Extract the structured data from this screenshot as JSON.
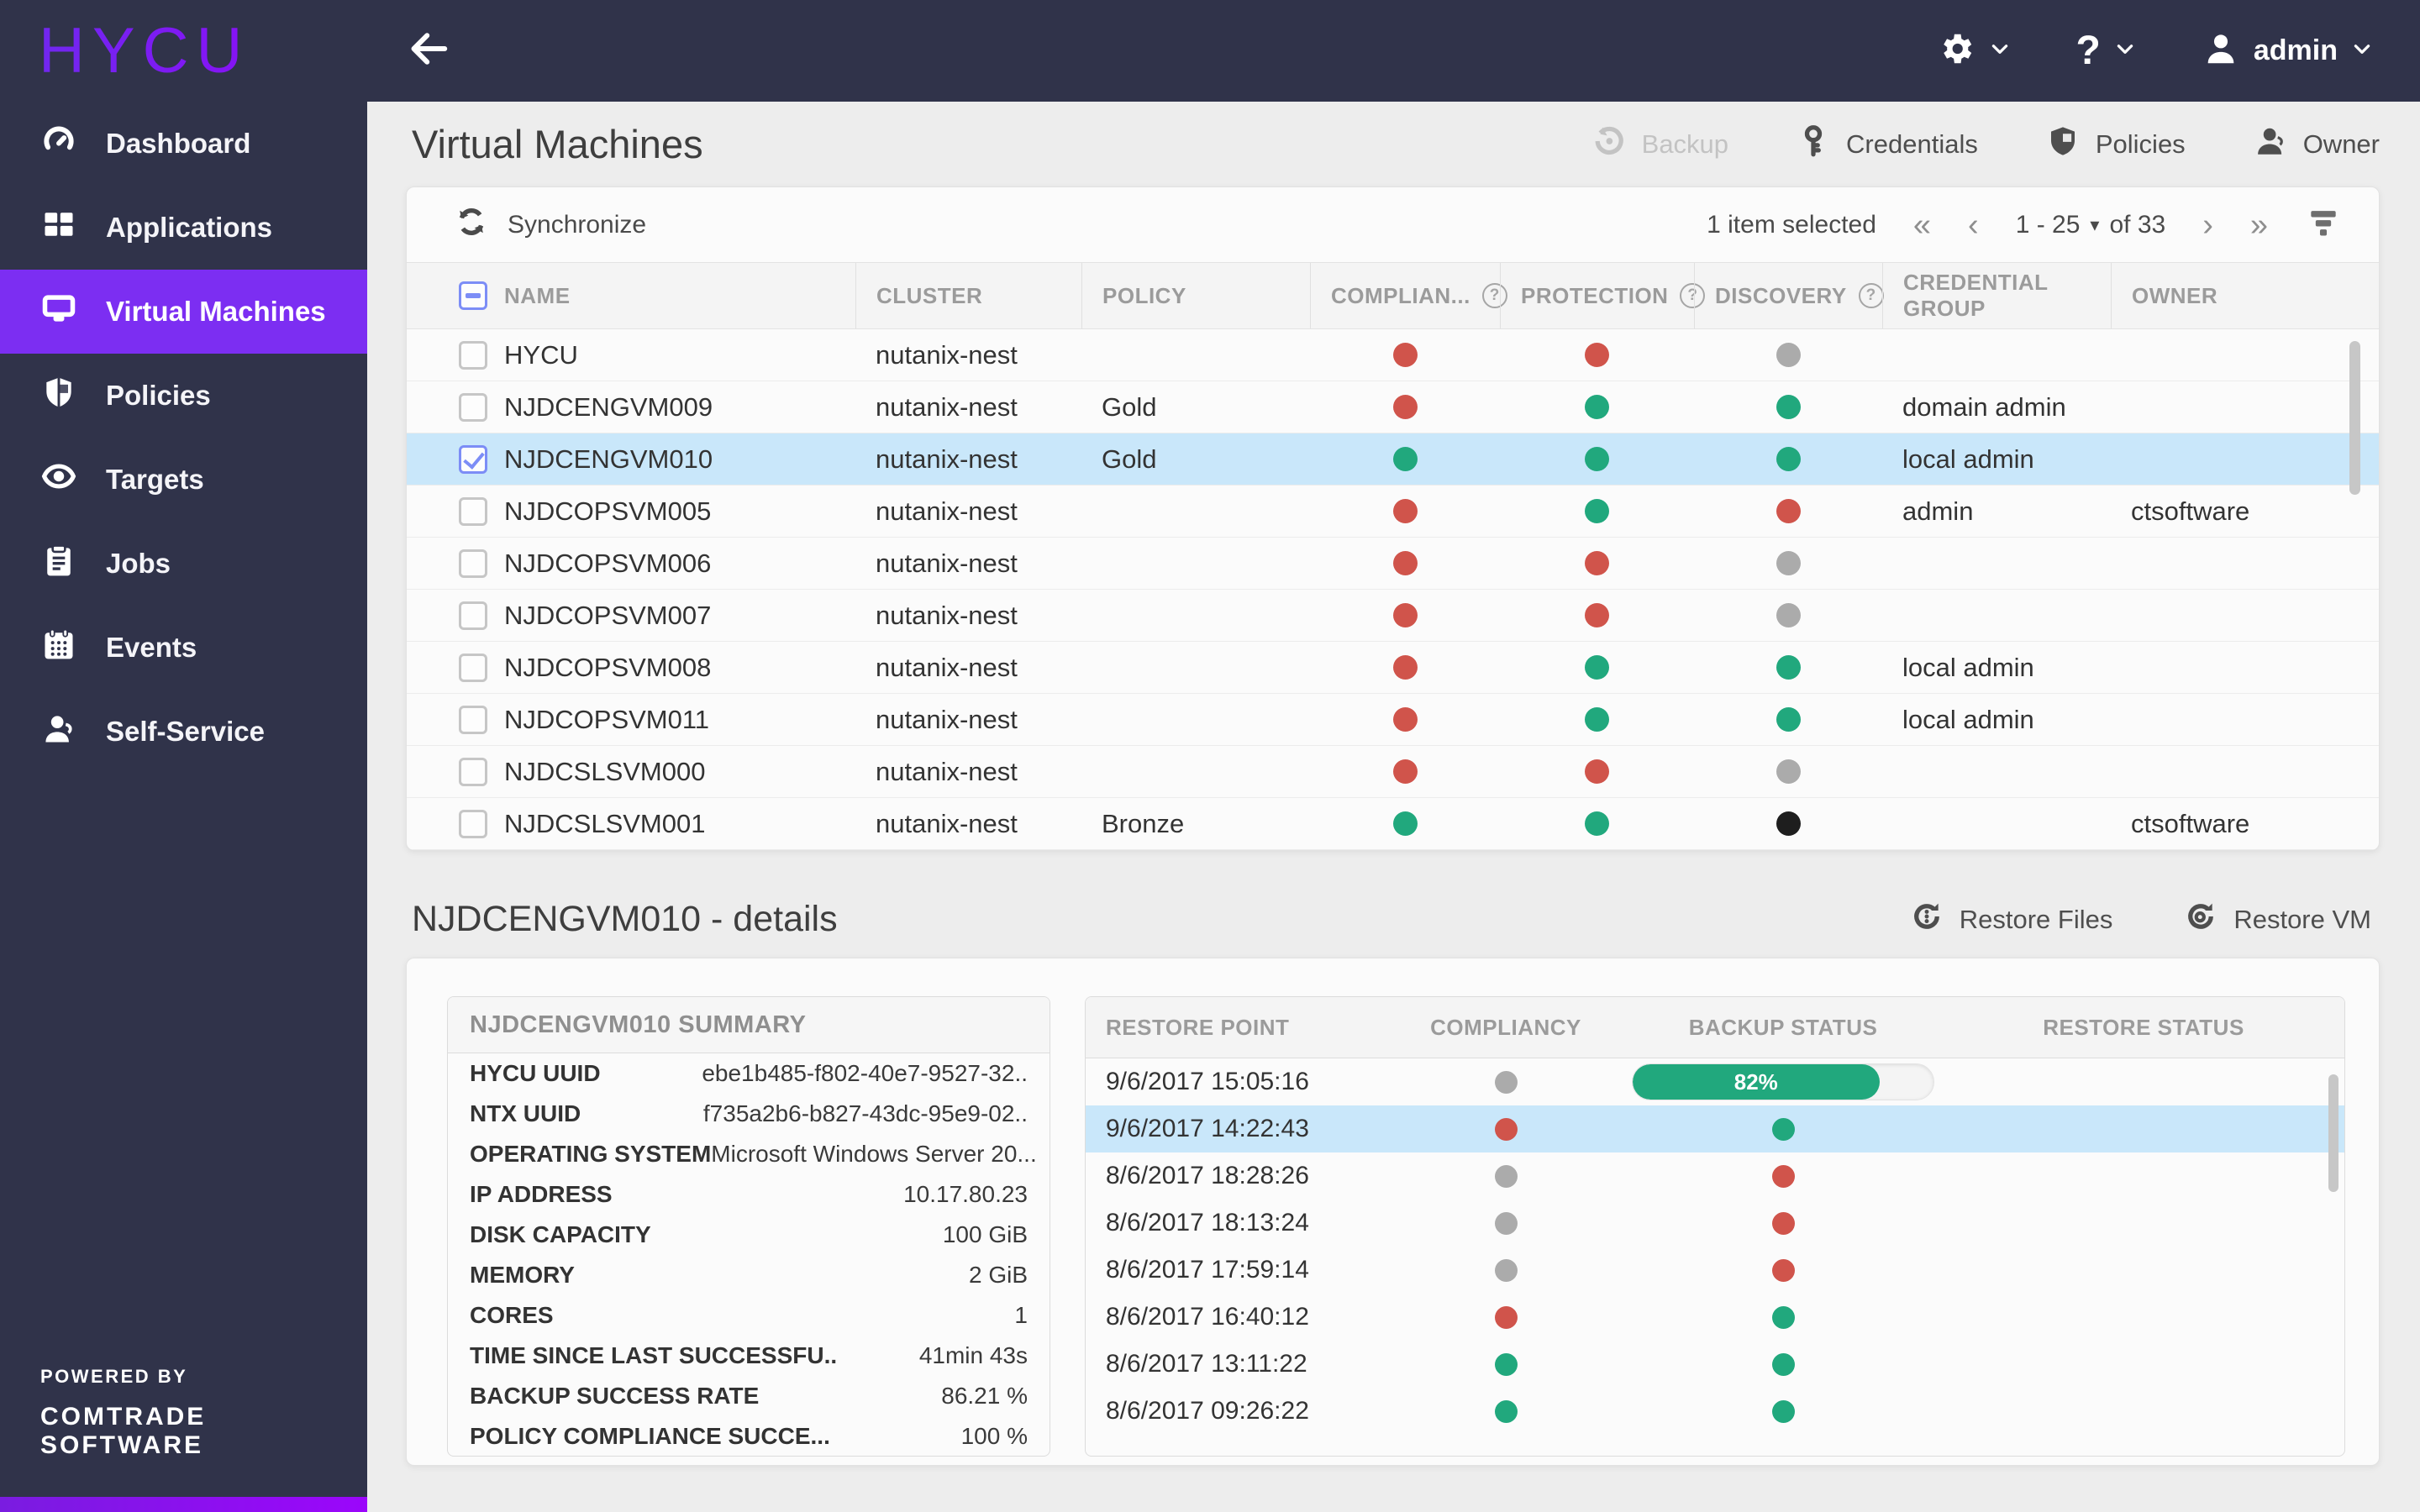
{
  "colors": {
    "accent": "#7C2EF2",
    "topbar_bg": "#30334A",
    "status_red": "#D0544B",
    "status_green": "#21A87D",
    "status_gray": "#ABABAB",
    "status_black": "#1E1E1E",
    "selected_row": "#C9E7FA"
  },
  "brand": {
    "logo": "HYCU",
    "powered_by": "POWERED BY",
    "company": "COMTRADE SOFTWARE"
  },
  "topbar": {
    "user": "admin",
    "help_glyph": "?"
  },
  "sidebar": {
    "items": [
      {
        "label": "Dashboard"
      },
      {
        "label": "Applications"
      },
      {
        "label": "Virtual Machines",
        "active": true
      },
      {
        "label": "Policies"
      },
      {
        "label": "Targets"
      },
      {
        "label": "Jobs"
      },
      {
        "label": "Events"
      },
      {
        "label": "Self-Service"
      }
    ]
  },
  "page": {
    "title": "Virtual Machines",
    "actions": {
      "backup": "Backup",
      "credentials": "Credentials",
      "policies": "Policies",
      "owner": "Owner"
    }
  },
  "vm_table": {
    "synchronize_label": "Synchronize",
    "selection_status": "1 item selected",
    "help_glyph": "?",
    "pagination": {
      "first_icon": "«",
      "prev_icon": "‹",
      "range": "1 - 25",
      "caret_icon": "▾",
      "of_total": "of 33",
      "next_icon": "›",
      "last_icon": "»"
    },
    "columns": {
      "name": "NAME",
      "cluster": "CLUSTER",
      "policy": "POLICY",
      "compliancy": "COMPLIAN...",
      "protection": "PROTECTION",
      "discovery": "DISCOVERY",
      "credential_group": "CREDENTIAL GROUP",
      "owner": "OWNER"
    },
    "rows": [
      {
        "name": "HYCU",
        "cluster": "nutanix-nest",
        "policy": "",
        "compliancy": "red",
        "protection": "red",
        "discovery": "gray",
        "credential_group": "",
        "owner": "",
        "selected": false
      },
      {
        "name": "NJDCENGVM009",
        "cluster": "nutanix-nest",
        "policy": "Gold",
        "compliancy": "red",
        "protection": "green",
        "discovery": "green",
        "credential_group": "domain admin",
        "owner": "",
        "selected": false
      },
      {
        "name": "NJDCENGVM010",
        "cluster": "nutanix-nest",
        "policy": "Gold",
        "compliancy": "green",
        "protection": "green",
        "discovery": "green",
        "credential_group": "local admin",
        "owner": "",
        "selected": true
      },
      {
        "name": "NJDCOPSVM005",
        "cluster": "nutanix-nest",
        "policy": "",
        "compliancy": "red",
        "protection": "green",
        "discovery": "red",
        "credential_group": "admin",
        "owner": "ctsoftware",
        "selected": false
      },
      {
        "name": "NJDCOPSVM006",
        "cluster": "nutanix-nest",
        "policy": "",
        "compliancy": "red",
        "protection": "red",
        "discovery": "gray",
        "credential_group": "",
        "owner": "",
        "selected": false
      },
      {
        "name": "NJDCOPSVM007",
        "cluster": "nutanix-nest",
        "policy": "",
        "compliancy": "red",
        "protection": "red",
        "discovery": "gray",
        "credential_group": "",
        "owner": "",
        "selected": false
      },
      {
        "name": "NJDCOPSVM008",
        "cluster": "nutanix-nest",
        "policy": "",
        "compliancy": "red",
        "protection": "green",
        "discovery": "green",
        "credential_group": "local admin",
        "owner": "",
        "selected": false
      },
      {
        "name": "NJDCOPSVM011",
        "cluster": "nutanix-nest",
        "policy": "",
        "compliancy": "red",
        "protection": "green",
        "discovery": "green",
        "credential_group": "local admin",
        "owner": "",
        "selected": false
      },
      {
        "name": "NJDCSLSVM000",
        "cluster": "nutanix-nest",
        "policy": "",
        "compliancy": "red",
        "protection": "red",
        "discovery": "gray",
        "credential_group": "",
        "owner": "",
        "selected": false
      },
      {
        "name": "NJDCSLSVM001",
        "cluster": "nutanix-nest",
        "policy": "Bronze",
        "compliancy": "green",
        "protection": "green",
        "discovery": "black",
        "credential_group": "",
        "owner": "ctsoftware",
        "selected": false
      }
    ]
  },
  "details": {
    "title": "NJDCENGVM010 - details",
    "restore_files_label": "Restore Files",
    "restore_vm_label": "Restore VM",
    "summary": {
      "header": "NJDCENGVM010 SUMMARY",
      "rows": [
        {
          "label": "HYCU UUID",
          "value": "ebe1b485-f802-40e7-9527-32.."
        },
        {
          "label": "NTX UUID",
          "value": "f735a2b6-b827-43dc-95e9-02.."
        },
        {
          "label": "OPERATING SYSTEM",
          "value": "Microsoft Windows Server 20..."
        },
        {
          "label": "IP ADDRESS",
          "value": "10.17.80.23"
        },
        {
          "label": "DISK CAPACITY",
          "value": "100 GiB"
        },
        {
          "label": "MEMORY",
          "value": "2 GiB"
        },
        {
          "label": "CORES",
          "value": "1"
        },
        {
          "label": "TIME SINCE LAST SUCCESSFU..",
          "value": "41min 43s"
        },
        {
          "label": "BACKUP SUCCESS RATE",
          "value": "86.21 %"
        },
        {
          "label": "POLICY COMPLIANCE SUCCE...",
          "value": "100 %"
        }
      ]
    },
    "restore_points": {
      "columns": {
        "restore_point": "RESTORE POINT",
        "compliancy": "COMPLIANCY",
        "backup_status": "BACKUP STATUS",
        "restore_status": "RESTORE STATUS"
      },
      "rows": [
        {
          "time": "9/6/2017 15:05:16",
          "compliancy": "gray",
          "backup": "progress",
          "progress_percent": 82,
          "progress_label": "82%",
          "selected": false
        },
        {
          "time": "9/6/2017 14:22:43",
          "compliancy": "red",
          "backup": "green",
          "selected": true
        },
        {
          "time": "8/6/2017 18:28:26",
          "compliancy": "gray",
          "backup": "red",
          "selected": false
        },
        {
          "time": "8/6/2017 18:13:24",
          "compliancy": "gray",
          "backup": "red",
          "selected": false
        },
        {
          "time": "8/6/2017 17:59:14",
          "compliancy": "gray",
          "backup": "red",
          "selected": false
        },
        {
          "time": "8/6/2017 16:40:12",
          "compliancy": "red",
          "backup": "green",
          "selected": false
        },
        {
          "time": "8/6/2017 13:11:22",
          "compliancy": "green",
          "backup": "green",
          "selected": false
        },
        {
          "time": "8/6/2017 09:26:22",
          "compliancy": "green",
          "backup": "green",
          "selected": false
        }
      ]
    }
  }
}
